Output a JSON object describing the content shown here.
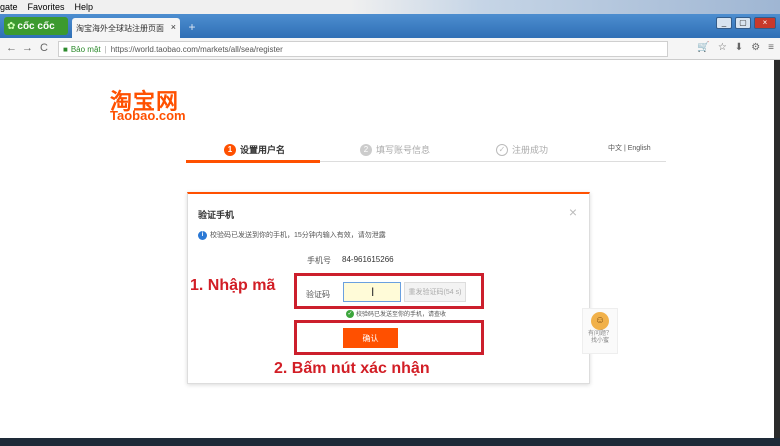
{
  "menu": {
    "items": [
      "gate",
      "Favorites",
      "Help"
    ]
  },
  "browser": {
    "brand": "cốc cốc",
    "tab_title": "淘宝海外全球站注册页面",
    "tab_close": "×",
    "new_tab": "+",
    "nav_back": "←",
    "nav_forward": "→",
    "nav_reload": "C",
    "security_text": "Bảo mật",
    "url": "https://world.taobao.com/markets/all/sea/register",
    "window_min": "_",
    "window_max": "▢",
    "window_close": "×"
  },
  "page": {
    "logo_cn": "淘宝网",
    "logo_en": "Taobao.com",
    "steps": [
      {
        "num": "1",
        "label": "设置用户名"
      },
      {
        "num": "2",
        "label": "填写账号信息"
      },
      {
        "num": "✓",
        "label": "注册成功"
      }
    ],
    "language": "中文 | English"
  },
  "modal": {
    "title": "验证手机",
    "close": "×",
    "info": "校验码已发送到你的手机，15分钟内输入有效，请勿泄露",
    "phone_label": "手机号",
    "phone_value": "84-961615266",
    "code_label": "验证码",
    "resend_label": "重发验证码(54 s)",
    "sent_notice": "校验码已发送至你的手机，请查收",
    "confirm_label": "确认"
  },
  "annotations": {
    "step1": "1. Nhập mã",
    "step2": "2. Bấm nút xác nhận",
    "color": "#d21e26"
  },
  "helper": {
    "line1": "有问题？",
    "line2": "找小蜜"
  },
  "colors": {
    "brand_orange": "#ff5000",
    "browser_blue": "#2f6fb5",
    "highlight_red": "#cc1f2c"
  }
}
